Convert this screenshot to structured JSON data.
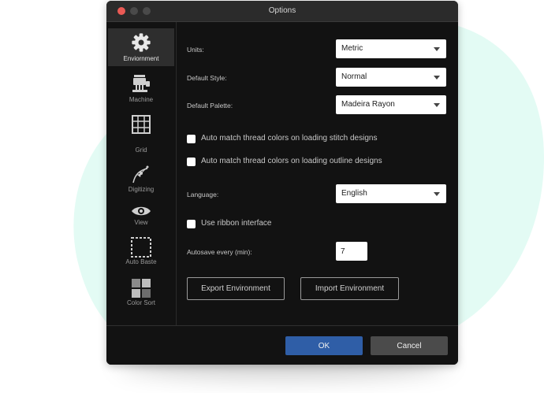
{
  "window": {
    "title": "Options"
  },
  "colors": {
    "accent": "#2f5ea7",
    "blob": "#e3fbf4",
    "window_bg": "#121212"
  },
  "sidebar": {
    "items": [
      {
        "label": "Enviornment",
        "icon": "gear-icon",
        "active": true
      },
      {
        "label": "Machine",
        "icon": "machine-icon",
        "active": false
      },
      {
        "label": "Grid",
        "icon": "grid-icon",
        "active": false
      },
      {
        "label": "Digitizing",
        "icon": "bezier-pen-icon",
        "active": false
      },
      {
        "label": "View",
        "icon": "eye-icon",
        "active": false
      },
      {
        "label": "Auto Baste",
        "icon": "dashed-square-icon",
        "active": false
      },
      {
        "label": "Color Sort",
        "icon": "color-grid-icon",
        "active": false
      }
    ]
  },
  "form": {
    "units": {
      "label": "Units:",
      "value": "Metric"
    },
    "default_style": {
      "label": "Default Style:",
      "value": "Normal"
    },
    "default_palette": {
      "label": "Default Palette:",
      "value": "Madeira Rayon"
    },
    "auto_match_stitch": {
      "label": "Auto match thread colors on loading stitch designs",
      "checked": false
    },
    "auto_match_outline": {
      "label": "Auto match thread colors on loading outline designs",
      "checked": false
    },
    "language": {
      "label": "Language:",
      "value": "English"
    },
    "ribbon": {
      "label": "Use ribbon interface",
      "checked": false
    },
    "autosave": {
      "label": "Autosave every (min):",
      "value": "7"
    },
    "export_label": "Export Environment",
    "import_label": "Import Environment"
  },
  "footer": {
    "ok_label": "OK",
    "cancel_label": "Cancel"
  }
}
